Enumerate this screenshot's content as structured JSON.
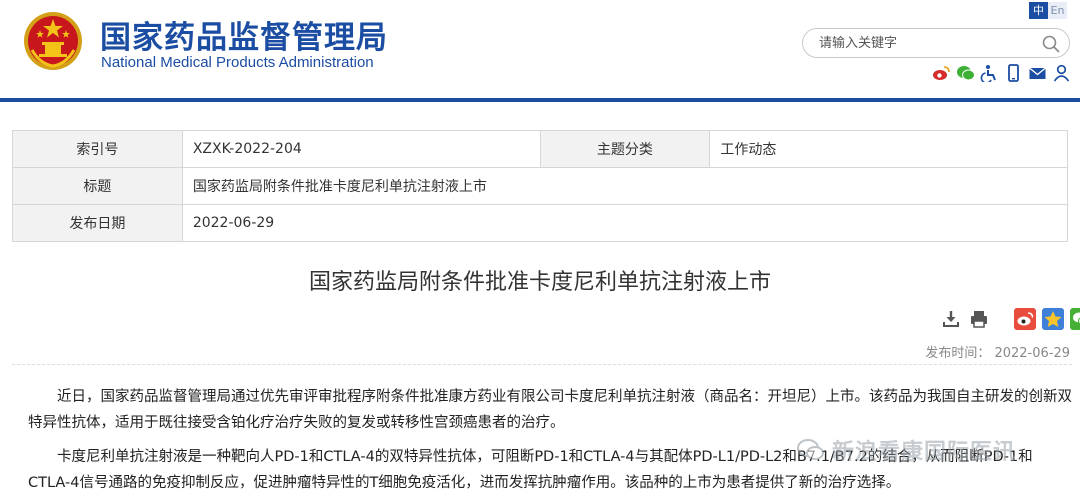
{
  "header": {
    "site_name_cn": "国家药品监督管理局",
    "site_name_en": "National Medical Products Administration",
    "lang": {
      "cn": "中",
      "en": "En"
    },
    "search": {
      "placeholder": "请输入关键字",
      "value": ""
    },
    "quick_icons": [
      "weibo-icon",
      "wechat-icon",
      "accessibility-icon",
      "mobile-icon",
      "mail-icon",
      "user-icon"
    ]
  },
  "info_table": {
    "index_label": "索引号",
    "index_value": "XZXK-2022-204",
    "category_label": "主题分类",
    "category_value": "工作动态",
    "title_label": "标题",
    "title_value": "国家药监局附条件批准卡度尼利单抗注射液上市",
    "date_label": "发布日期",
    "date_value": "2022-06-29"
  },
  "article": {
    "title": "国家药监局附条件批准卡度尼利单抗注射液上市",
    "publish_label": "发布时间：",
    "publish_time": "2022-06-29",
    "paragraphs": [
      "近日，国家药品监督管理局通过优先审评审批程序附条件批准康方药业有限公司卡度尼利单抗注射液（商品名：开坦尼）上市。该药品为我国自主研发的创新双特异性抗体，适用于既往接受含铂化疗治疗失败的复发或转移性宫颈癌患者的治疗。",
      "卡度尼利单抗注射液是一种靶向人PD-1和CTLA-4的双特异性抗体，可阻断PD-1和CTLA-4与其配体PD-L1/PD-L2和B7.1/B7.2的结合，从而阻断PD-1和CTLA-4信号通路的免疫抑制反应，促进肿瘤特异性的T细胞免疫活化，进而发挥抗肿瘤作用。该品种的上市为患者提供了新的治疗选择。"
    ]
  },
  "toolbar": {
    "icons": [
      "download-icon",
      "print-icon",
      "weibo-share-icon",
      "qzone-share-icon",
      "wechat-share-icon"
    ]
  },
  "watermark": {
    "text": "新浪看康国际医讯"
  },
  "colors": {
    "brand_blue": "#1b4da3",
    "label_bg": "#f2f2f2"
  }
}
